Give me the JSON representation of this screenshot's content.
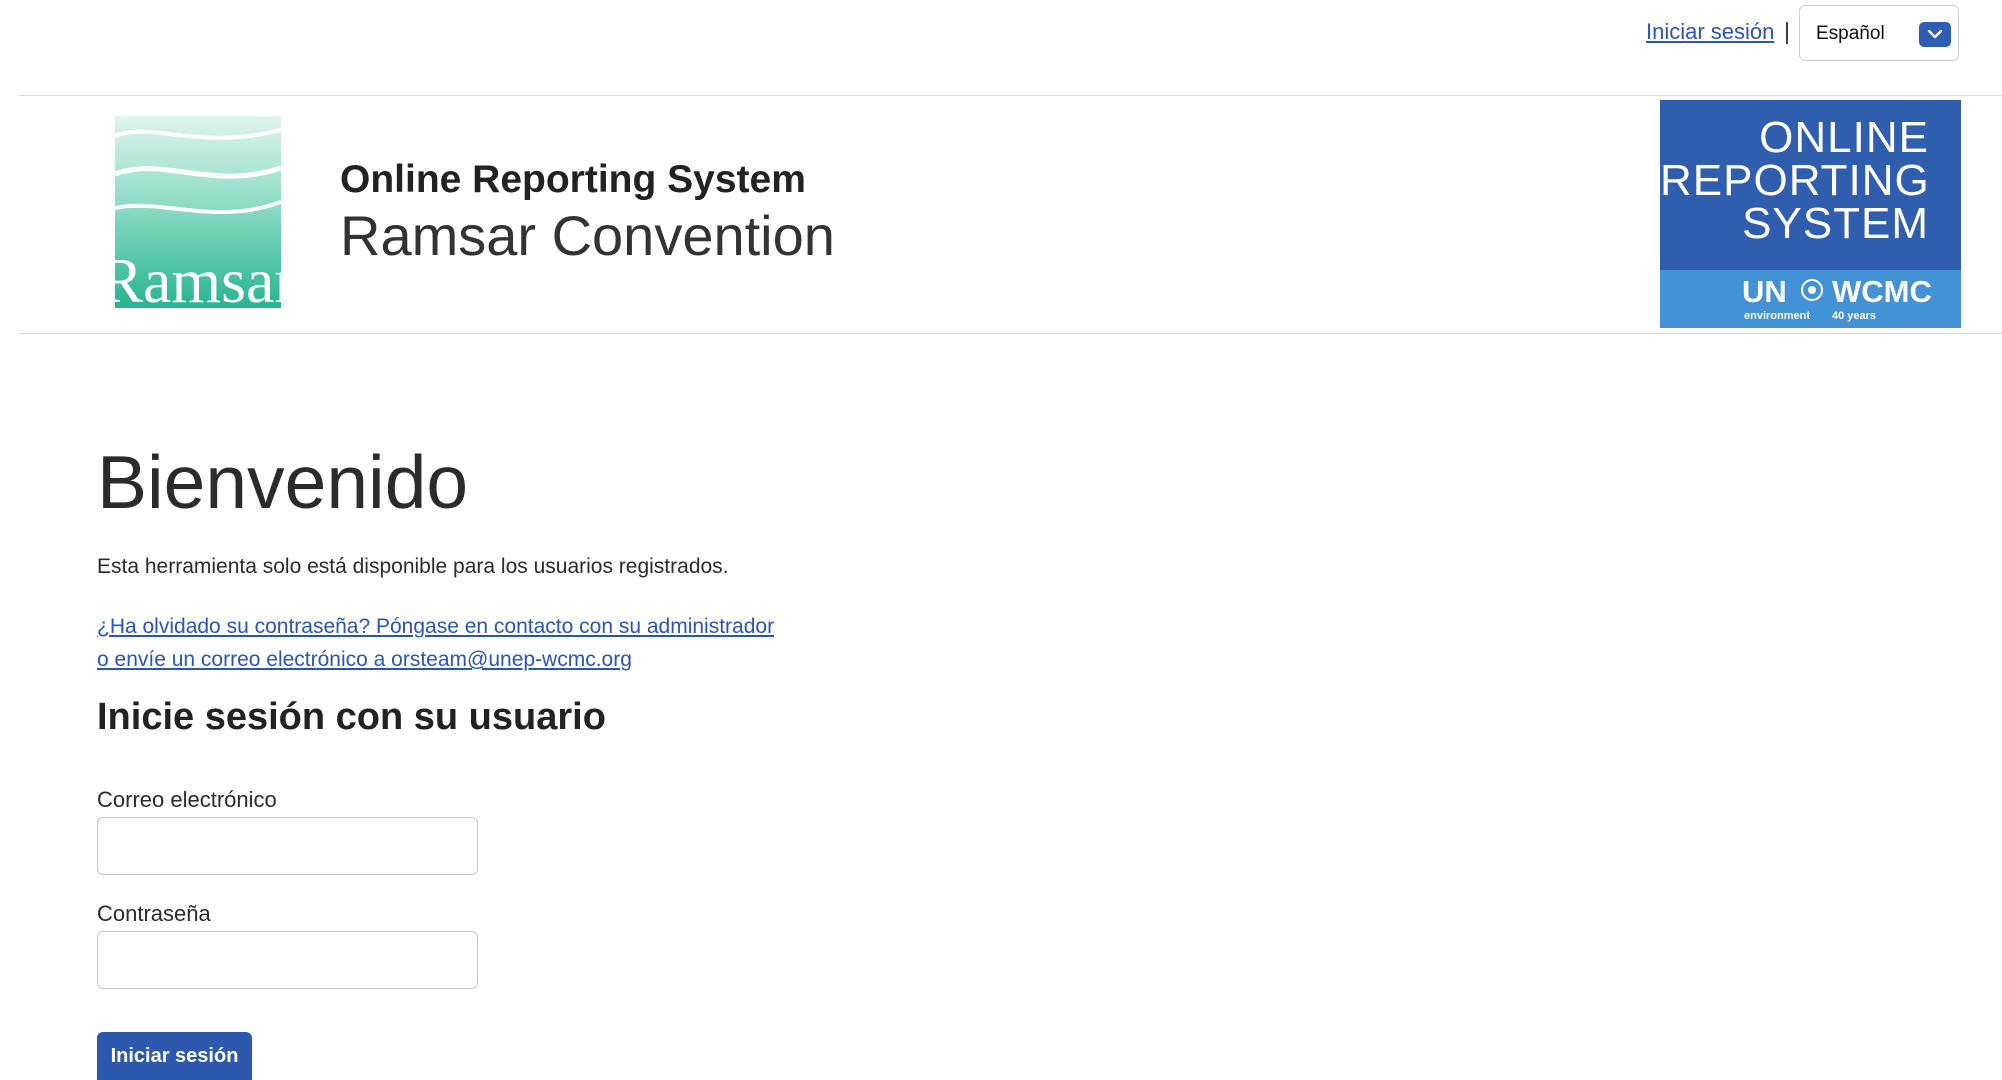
{
  "topbar": {
    "login_link": "Iniciar sesión",
    "separator": "|",
    "language": {
      "selected": "Español"
    }
  },
  "header": {
    "logo_text": "Ramsar",
    "system_name": "Online Reporting System",
    "convention_name": "Ramsar Convention",
    "badge": {
      "line1": "ONLINE",
      "line2": "REPORTING",
      "line3": "SYSTEM",
      "un": "UN",
      "un_sub": "environment",
      "wcmc": "WCMC",
      "wcmc_sub": "40 years"
    }
  },
  "main": {
    "title": "Bienvenido",
    "intro": "Esta herramienta solo está disponible para los usuarios registrados.",
    "forgot_line1": "¿Ha olvidado su contraseña? Póngase en contacto con su administrador",
    "forgot_line2": "o envíe un correo electrónico a orsteam@unep-wcmc.org",
    "login_heading": "Inicie sesión con su usuario",
    "email_label": "Correo electrónico",
    "email_value": "",
    "password_label": "Contraseña",
    "password_value": "",
    "submit_label": "Iniciar sesión"
  },
  "colors": {
    "link": "#2a55b6",
    "primary_button": "#2c58ad",
    "badge_dark": "#2f5eae",
    "badge_light": "#4392d6",
    "logo_teal": "#3cbfa0"
  }
}
